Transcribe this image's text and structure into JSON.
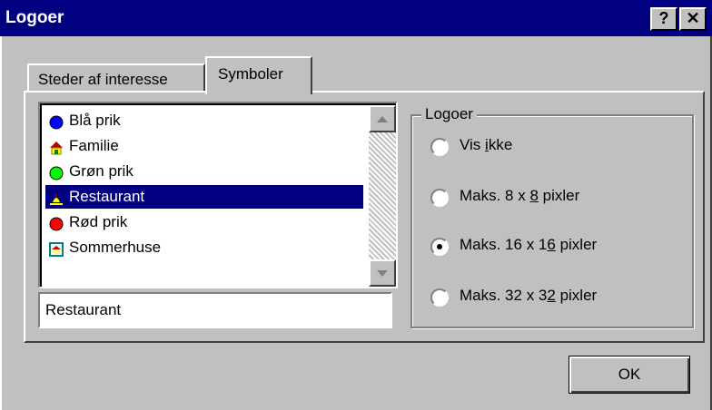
{
  "window": {
    "title": "Logoer",
    "help_button": "?",
    "close_button": "✕"
  },
  "tabs": [
    {
      "label": "Steder af interesse",
      "active": false
    },
    {
      "label": "Symboler",
      "active": true
    }
  ],
  "symbol_list": {
    "items": [
      {
        "label": "Blå prik",
        "icon": "blue-dot-icon",
        "color": "#0000ff",
        "selected": false
      },
      {
        "label": "Familie",
        "icon": "house-icon",
        "color": "#c00000",
        "selected": false
      },
      {
        "label": "Grøn prik",
        "icon": "green-dot-icon",
        "color": "#00ff00",
        "selected": false
      },
      {
        "label": "Restaurant",
        "icon": "restaurant-icon",
        "color": "#ffff00",
        "selected": true
      },
      {
        "label": "Rød prik",
        "icon": "red-dot-icon",
        "color": "#ff0000",
        "selected": false
      },
      {
        "label": "Sommerhuse",
        "icon": "summerhouse-icon",
        "color": "#008080",
        "selected": false
      }
    ]
  },
  "name_field": {
    "value": "Restaurant"
  },
  "logo_group": {
    "legend": "Logoer",
    "options": [
      {
        "pre": "Vis ",
        "key": "i",
        "post": "kke",
        "checked": false
      },
      {
        "pre": "Maks. 8 x ",
        "key": "8",
        "post": " pixler",
        "checked": false
      },
      {
        "pre": "Maks. 16 x 1",
        "key": "6",
        "post": " pixler",
        "checked": true
      },
      {
        "pre": "Maks. 32 x 3",
        "key": "2",
        "post": " pixler",
        "checked": false
      }
    ]
  },
  "ok_button": {
    "label": "OK"
  }
}
